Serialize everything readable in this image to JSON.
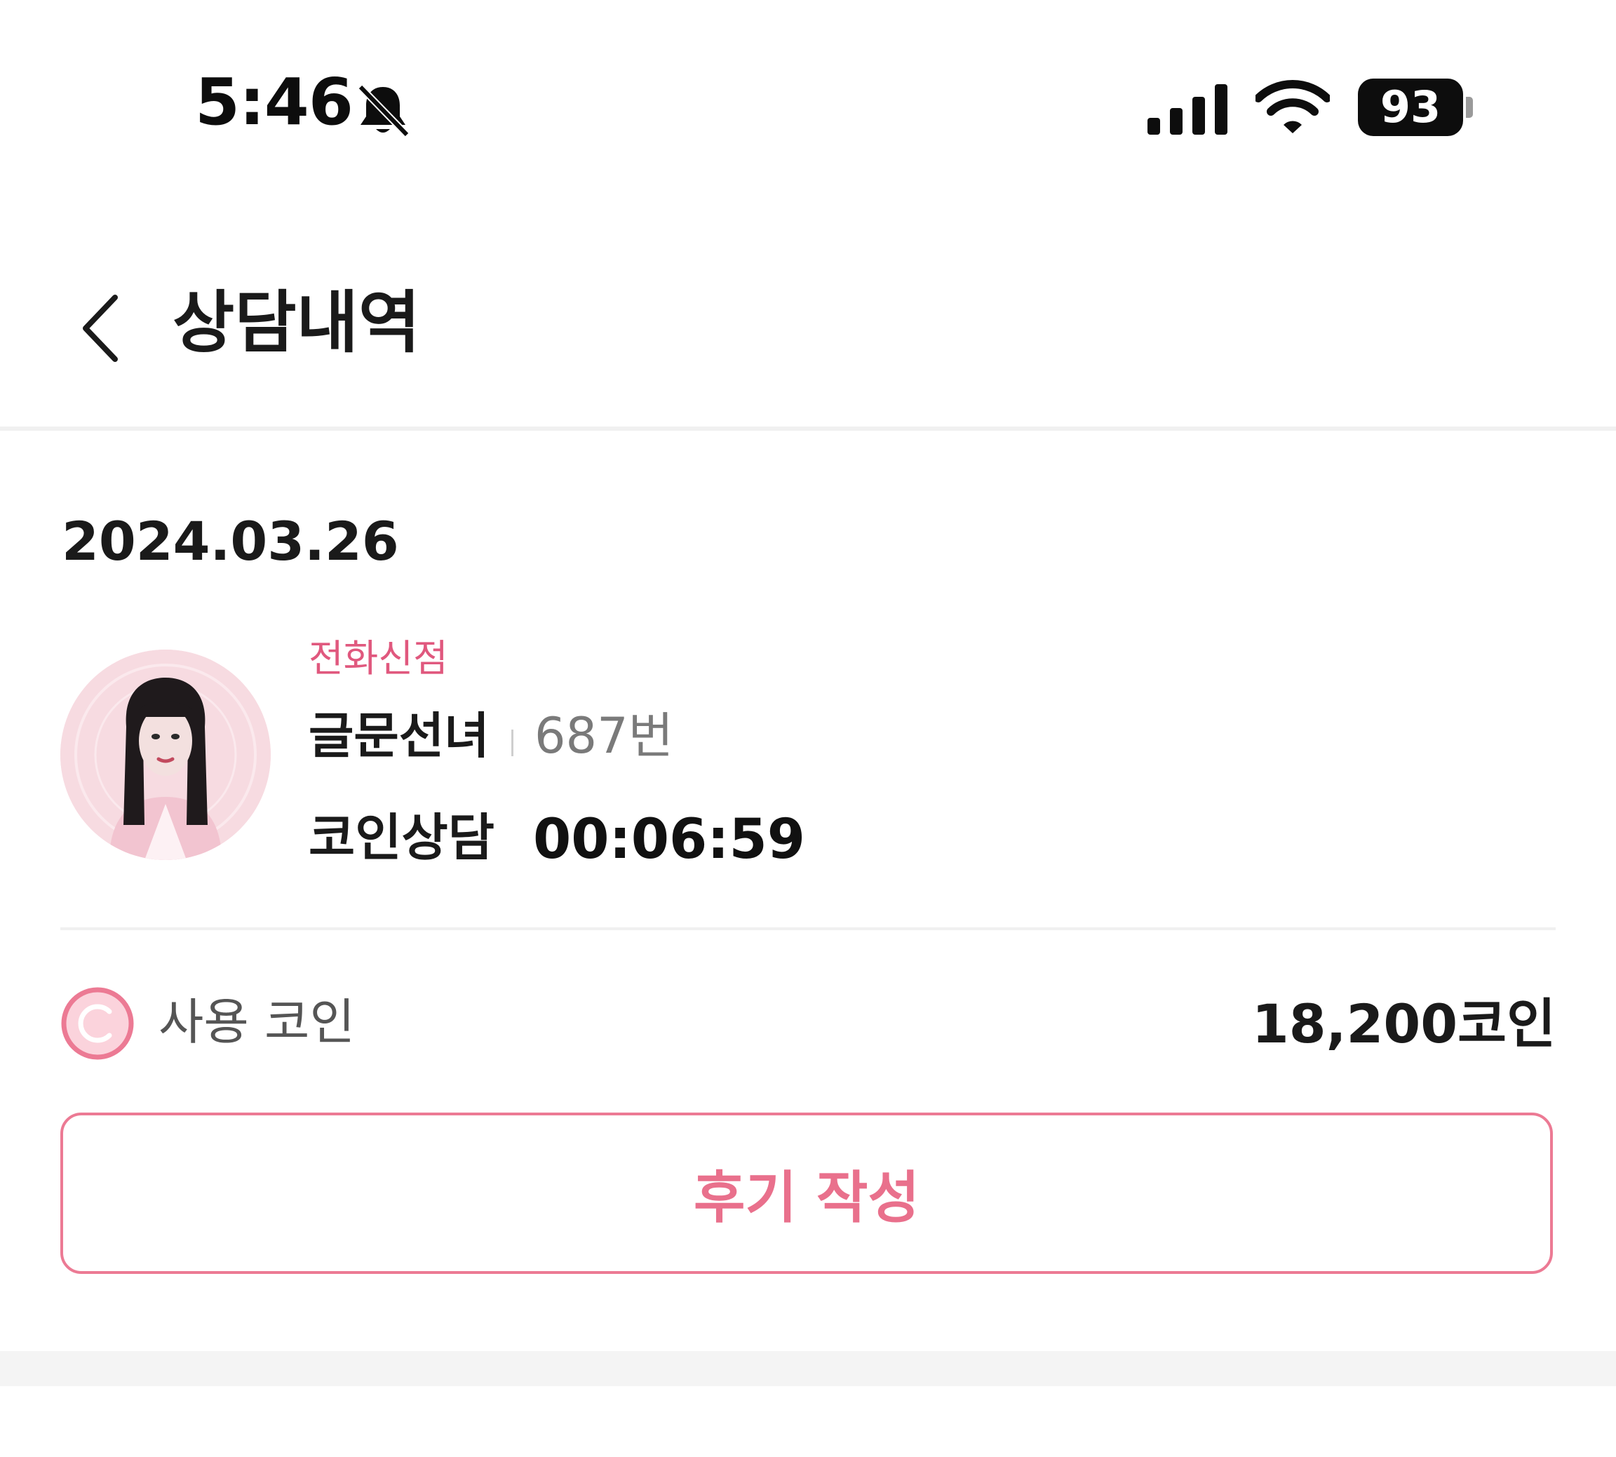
{
  "status_bar": {
    "time": "5:46",
    "battery_level": "93",
    "icons": [
      "bell-slash-icon",
      "cellular-signal-icon",
      "wifi-icon",
      "battery-icon"
    ]
  },
  "header": {
    "back_icon": "chevron-left-icon",
    "title": "상담내역"
  },
  "history": [
    {
      "date": "2024.03.26",
      "service_type": "전화신점",
      "counselor_name": "글문선녀",
      "counselor_number": "687번",
      "consult_label": "코인상담",
      "consult_duration": "00:06:59",
      "coin_icon": "coin-c-icon",
      "coin_label": "사용 코인",
      "coin_amount": "18,200코인",
      "review_button_label": "후기 작성"
    }
  ],
  "colors": {
    "accent_pink": "#e9708c",
    "service_pink": "#e0587e",
    "avatar_bg": "#f7dbe1",
    "text_dark": "#1a1a1a",
    "text_gray": "#7a7a7a",
    "divider": "#f0f0f0"
  }
}
